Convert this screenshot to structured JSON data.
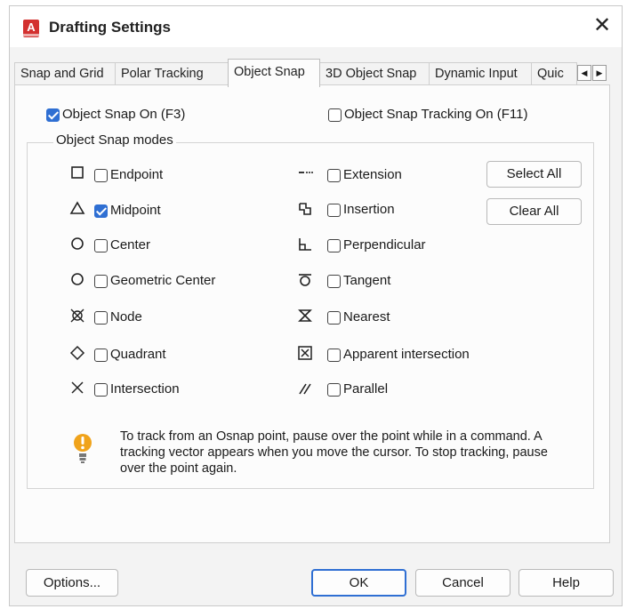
{
  "window": {
    "title": "Drafting Settings",
    "app_icon_letter": "A",
    "close_glyph": "✕"
  },
  "tabs": [
    {
      "label": "Snap and Grid"
    },
    {
      "label": "Polar Tracking"
    },
    {
      "label": "Object Snap"
    },
    {
      "label": "3D Object Snap"
    },
    {
      "label": "Dynamic Input"
    },
    {
      "label": "Quic"
    }
  ],
  "tab_scroll": {
    "left": "◀",
    "right": "▶"
  },
  "object_snap": {
    "osnap_on": {
      "label": "Object Snap On (F3)",
      "checked": true
    },
    "osnap_tracking": {
      "label": "Object Snap Tracking On (F11)",
      "checked": false
    },
    "group_title": "Object Snap modes",
    "left_modes": [
      {
        "label": "Endpoint",
        "icon": "square-icon",
        "checked": false
      },
      {
        "label": "Midpoint",
        "icon": "triangle-icon",
        "checked": true
      },
      {
        "label": "Center",
        "icon": "circle-icon",
        "checked": false
      },
      {
        "label": "Geometric Center",
        "icon": "circle-icon",
        "checked": false
      },
      {
        "label": "Node",
        "icon": "node-icon",
        "checked": false
      },
      {
        "label": "Quadrant",
        "icon": "diamond-icon",
        "checked": false
      },
      {
        "label": "Intersection",
        "icon": "x-icon",
        "checked": false
      }
    ],
    "right_modes": [
      {
        "label": "Extension",
        "icon": "extension-icon",
        "checked": false
      },
      {
        "label": "Insertion",
        "icon": "insertion-icon",
        "checked": false
      },
      {
        "label": "Perpendicular",
        "icon": "perpendicular-icon",
        "checked": false
      },
      {
        "label": "Tangent",
        "icon": "tangent-icon",
        "checked": false
      },
      {
        "label": "Nearest",
        "icon": "nearest-icon",
        "checked": false
      },
      {
        "label": "Apparent intersection",
        "icon": "apparent-intersection-icon",
        "checked": false
      },
      {
        "label": "Parallel",
        "icon": "parallel-icon",
        "checked": false
      }
    ],
    "select_all": "Select All",
    "clear_all": "Clear All",
    "info_text": "To track from an Osnap point, pause over the point while in a command.  A tracking vector appears when you move the cursor.  To stop tracking, pause over the point again."
  },
  "footer": {
    "options": "Options...",
    "ok": "OK",
    "cancel": "Cancel",
    "help": "Help"
  },
  "colors": {
    "accent": "#2f6fd3",
    "app_icon": "#d3302f",
    "info_icon": "#f0a31b"
  }
}
